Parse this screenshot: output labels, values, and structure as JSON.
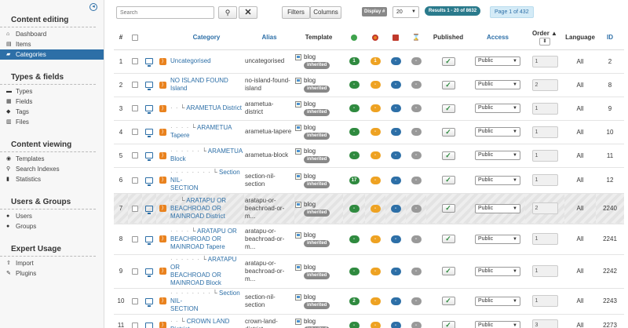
{
  "sidebar": {
    "sections": [
      {
        "title": "Content editing",
        "items": [
          {
            "label": "Dashboard",
            "icon": "home-icon"
          },
          {
            "label": "Items",
            "icon": "document-icon"
          },
          {
            "label": "Categories",
            "icon": "folder-icon",
            "active": true
          }
        ]
      },
      {
        "title": "Types & fields",
        "items": [
          {
            "label": "Types",
            "icon": "types-icon"
          },
          {
            "label": "Fields",
            "icon": "fields-icon"
          },
          {
            "label": "Tags",
            "icon": "tag-icon"
          },
          {
            "label": "Files",
            "icon": "file-icon"
          }
        ]
      },
      {
        "title": "Content viewing",
        "items": [
          {
            "label": "Templates",
            "icon": "eye-icon"
          },
          {
            "label": "Search Indexes",
            "icon": "search-icon"
          },
          {
            "label": "Statistics",
            "icon": "chart-icon"
          }
        ]
      },
      {
        "title": "Users & Groups",
        "items": [
          {
            "label": "Users",
            "icon": "user-icon"
          },
          {
            "label": "Groups",
            "icon": "group-icon"
          }
        ]
      },
      {
        "title": "Expert Usage",
        "items": [
          {
            "label": "Import",
            "icon": "upload-icon"
          },
          {
            "label": "Plugins",
            "icon": "plugin-icon"
          }
        ]
      }
    ]
  },
  "toolbar": {
    "search_placeholder": "Search",
    "filters_label": "Filters",
    "columns_label": "Columns",
    "display_label": "Display #",
    "display_value": "20",
    "results_text": "Results 1 - 20 of 8632",
    "page_text": "Page 1 of 432"
  },
  "table": {
    "headers": {
      "num": "#",
      "category": "Category",
      "alias": "Alias",
      "template": "Template",
      "published": "Published",
      "access": "Access",
      "order": "Order",
      "language": "Language",
      "id": "ID"
    },
    "colors": {
      "green": "#2f8a3f",
      "orange": "#eea222",
      "blue": "#2d6fa7",
      "gray": "#999999"
    },
    "rows": [
      {
        "num": "1",
        "depth": 0,
        "category": [
          "Uncategorised"
        ],
        "alias": [
          "uncategorised"
        ],
        "template": "blog",
        "badge": "inherited",
        "c1": "1",
        "c2": "1",
        "c3": "-",
        "c4": "-",
        "access": "Public",
        "order": "1",
        "language": "All",
        "id": "2",
        "h": 30
      },
      {
        "num": "2",
        "depth": 0,
        "category": [
          "NO ISLAND FOUND",
          "Island"
        ],
        "alias": [
          "no-island-found-",
          "island"
        ],
        "template": "blog",
        "badge": "inherited",
        "c1": "-",
        "c2": "-",
        "c3": "-",
        "c4": "-",
        "access": "Public",
        "order": "2",
        "language": "All",
        "id": "8",
        "h": 30
      },
      {
        "num": "3",
        "depth": 1,
        "category": [
          "ARAMETUA District"
        ],
        "alias": [
          "arametua-",
          "district"
        ],
        "template": "blog",
        "badge": "inherited",
        "c1": "-",
        "c2": "-",
        "c3": "-",
        "c4": "-",
        "access": "Public",
        "order": "1",
        "language": "All",
        "id": "9",
        "h": 30
      },
      {
        "num": "4",
        "depth": 2,
        "category": [
          "ARAMETUA",
          "Tapere"
        ],
        "alias": [
          "arametua-tapere"
        ],
        "template": "blog",
        "badge": "inherited",
        "c1": "-",
        "c2": "-",
        "c3": "-",
        "c4": "-",
        "access": "Public",
        "order": "1",
        "language": "All",
        "id": "10",
        "h": 30
      },
      {
        "num": "5",
        "depth": 3,
        "category": [
          "ARAMETUA",
          "Block"
        ],
        "alias": [
          "arametua-block"
        ],
        "template": "blog",
        "badge": "inherited",
        "c1": "-",
        "c2": "-",
        "c3": "-",
        "c4": "-",
        "access": "Public",
        "order": "1",
        "language": "All",
        "id": "11",
        "h": 30
      },
      {
        "num": "6",
        "depth": 4,
        "category": [
          "Section NIL-",
          "SECTION"
        ],
        "alias": [
          "section-nil-",
          "section"
        ],
        "template": "blog",
        "badge": "inherited",
        "c1": "17",
        "c2": "-",
        "c3": "-",
        "c4": "-",
        "access": "Public",
        "order": "1",
        "language": "All",
        "id": "12",
        "h": 30
      },
      {
        "num": "7",
        "depth": 1,
        "category": [
          "ARATAPU OR",
          "BEACHROAD OR",
          "MAINROAD District"
        ],
        "alias": [
          "aratapu-or-",
          "beachroad-or-",
          "m..."
        ],
        "template": "blog",
        "badge": "inherited",
        "c1": "-",
        "c2": "-",
        "c3": "-",
        "c4": "-",
        "access": "Public",
        "order": "2",
        "language": "All",
        "id": "2240",
        "h": 39,
        "highlight": true
      },
      {
        "num": "8",
        "depth": 2,
        "category": [
          "ARATAPU OR",
          "BEACHROAD OR",
          "MAINROAD Tapere"
        ],
        "alias": [
          "aratapu-or-",
          "beachroad-or-",
          "m..."
        ],
        "template": "blog",
        "badge": "inherited",
        "c1": "-",
        "c2": "-",
        "c3": "-",
        "c4": "-",
        "access": "Public",
        "order": "1",
        "language": "All",
        "id": "2241",
        "h": 39
      },
      {
        "num": "9",
        "depth": 3,
        "category": [
          "ARATAPU OR",
          "BEACHROAD OR",
          "MAINROAD Block"
        ],
        "alias": [
          "aratapu-or-",
          "beachroad-or-",
          "m..."
        ],
        "template": "blog",
        "badge": "inherited",
        "c1": "-",
        "c2": "-",
        "c3": "-",
        "c4": "-",
        "access": "Public",
        "order": "1",
        "language": "All",
        "id": "2242",
        "h": 39
      },
      {
        "num": "10",
        "depth": 4,
        "category": [
          "Section NIL-",
          "SECTION"
        ],
        "alias": [
          "section-nil-",
          "section"
        ],
        "template": "blog",
        "badge": "inherited",
        "c1": "2",
        "c2": "-",
        "c3": "-",
        "c4": "-",
        "access": "Public",
        "order": "1",
        "language": "All",
        "id": "2243",
        "h": 29
      },
      {
        "num": "11",
        "depth": 1,
        "category": [
          "CROWN LAND",
          "District"
        ],
        "alias": [
          "crown-land-",
          "district"
        ],
        "template": "blog",
        "badge": "inherited",
        "c1": "-",
        "c2": "-",
        "c3": "-",
        "c4": "-",
        "access": "Public",
        "order": "3",
        "language": "All",
        "id": "2273",
        "h": 29
      }
    ]
  }
}
